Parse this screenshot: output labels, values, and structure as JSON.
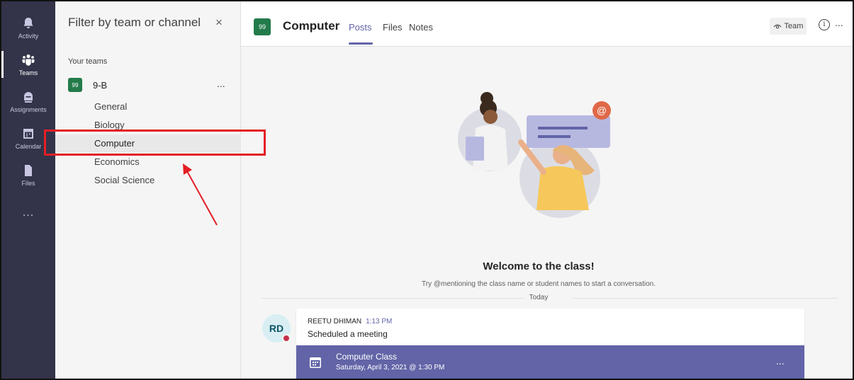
{
  "rail": {
    "items": [
      {
        "label": "Activity",
        "icon": "bell-icon"
      },
      {
        "label": "Teams",
        "icon": "teams-icon"
      },
      {
        "label": "Assignments",
        "icon": "assignments-icon"
      },
      {
        "label": "Calendar",
        "icon": "calendar-icon"
      },
      {
        "label": "Files",
        "icon": "file-icon"
      }
    ],
    "more": "..."
  },
  "panel": {
    "title": "Filter by team or channel",
    "close": "×",
    "section_label": "Your teams",
    "team": {
      "avatar": "99",
      "name": "9-B",
      "more": "..."
    },
    "channels": [
      "General",
      "Biology",
      "Computer",
      "Economics",
      "Social Science"
    ],
    "selected_channel": "Computer"
  },
  "header": {
    "avatar": "99",
    "title": "Computer",
    "tabs": [
      "Posts",
      "Files",
      "Notes"
    ],
    "active_tab": "Posts",
    "team_button": "Team",
    "info": "i",
    "more": "..."
  },
  "content": {
    "welcome": "Welcome to the class!",
    "subtext": "Try @mentioning the class name or student names to start a conversation.",
    "divider_label": "Today",
    "post": {
      "avatar": "RD",
      "author": "REETU DHIMAN",
      "time": "1:13 PM",
      "message": "Scheduled a meeting",
      "meeting": {
        "title": "Computer Class",
        "date": "Saturday, April 3, 2021 @ 1:30 PM",
        "more": "..."
      }
    }
  },
  "colors": {
    "rail": "#33344a",
    "accent": "#6264a7",
    "team_avatar": "#237b4b",
    "annotation": "#e31e24",
    "presence_busy": "#c4314b"
  }
}
